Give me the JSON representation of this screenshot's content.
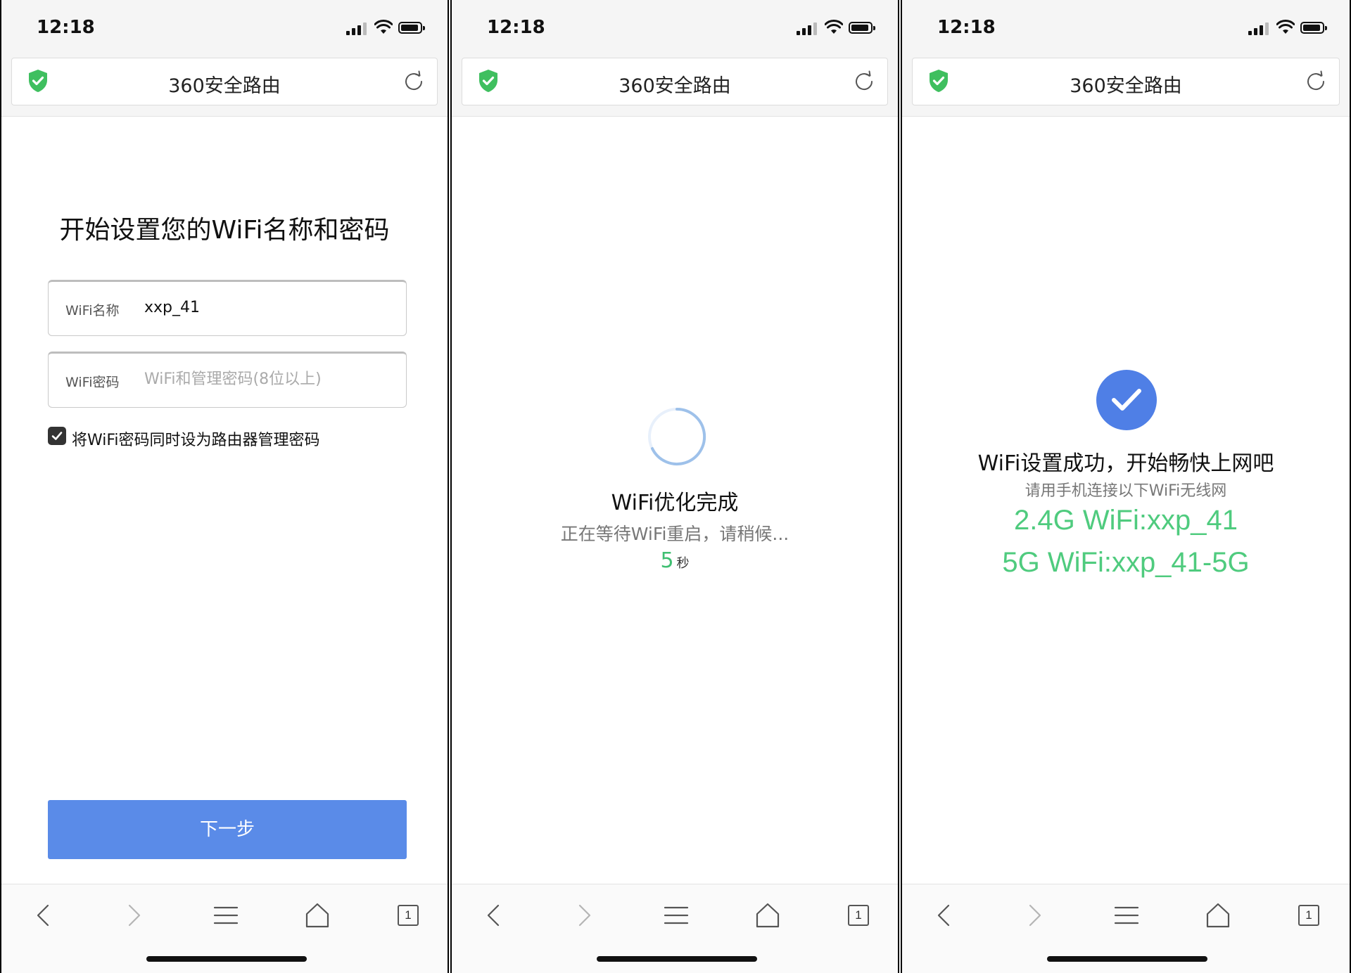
{
  "status_bar": {
    "time": "12:18"
  },
  "address_bar": {
    "site_title": "360安全路由"
  },
  "setup_screen": {
    "title": "开始设置您的WiFi名称和密码",
    "wifi_name_label": "WiFi名称",
    "wifi_name_value": "xxp_41",
    "wifi_password_label": "WiFi密码",
    "wifi_password_placeholder": "WiFi和管理密码(8位以上)",
    "sync_admin_checkbox_label": "将WiFi密码同时设为路由器管理密码",
    "sync_admin_checked": true,
    "next_button": "下一步"
  },
  "optimizing_screen": {
    "title": "WiFi优化完成",
    "subtitle": "正在等待WiFi重启，请稍候...",
    "countdown_value": "5",
    "countdown_unit": "秒"
  },
  "success_screen": {
    "title": "WiFi设置成功，开始畅快上网吧",
    "subtitle": "请用手机连接以下WiFi无线网",
    "ssid_24g": "2.4G WiFi:xxp_41",
    "ssid_5g": "5G WiFi:xxp_41-5G"
  },
  "toolbar": {
    "tab_count": "1"
  },
  "colors": {
    "accent_blue": "#5a8be8",
    "success_green": "#4fcb7e",
    "shield_green": "#3fbf5f",
    "badge_blue": "#4f7fe6"
  },
  "icons": [
    "shield-icon",
    "reload-icon",
    "back-icon",
    "forward-icon",
    "menu-icon",
    "home-icon",
    "tabs-icon",
    "spinner-icon",
    "success-check-icon",
    "checkbox-check-icon"
  ]
}
